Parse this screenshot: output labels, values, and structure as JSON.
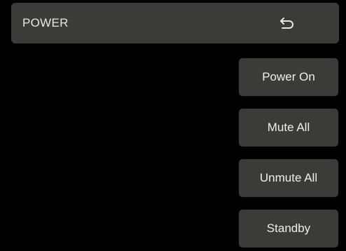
{
  "header": {
    "title": "POWER",
    "back_icon": "back-arrow-icon"
  },
  "actions": [
    {
      "label": "Power On"
    },
    {
      "label": "Mute All"
    },
    {
      "label": "Unmute All"
    },
    {
      "label": "Standby"
    }
  ],
  "colors": {
    "background": "#000000",
    "panel": "#3b3c3a",
    "text": "#eeeeee"
  }
}
